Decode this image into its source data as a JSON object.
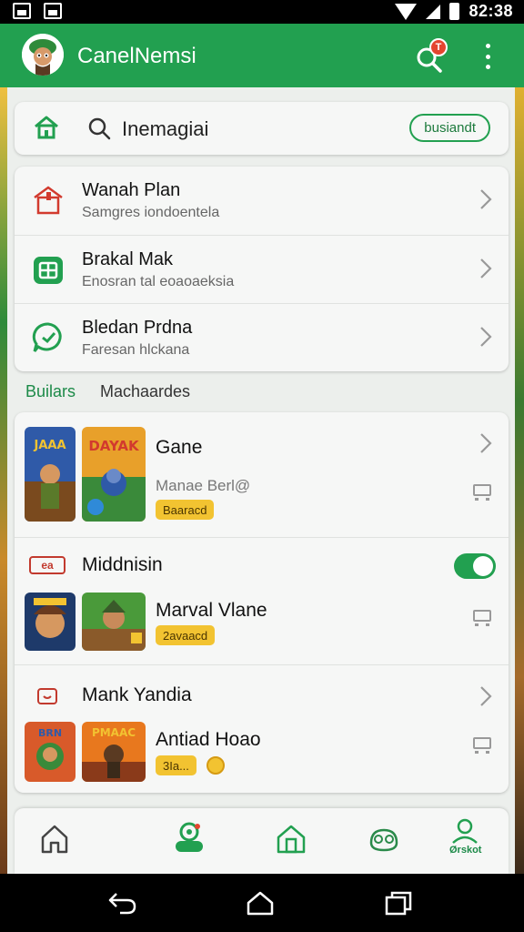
{
  "status_bar": {
    "time": "82:38"
  },
  "app_bar": {
    "title": "CanelNemsi",
    "notification_badge": "T"
  },
  "search": {
    "text": "Inemagiai",
    "pill_label": "busiandt"
  },
  "menu": [
    {
      "title": "Wanah Plan",
      "subtitle": "Samgres iondoentela",
      "icon": "shop-icon"
    },
    {
      "title": "Brakal Mak",
      "subtitle": "Enosran tal eoaoaeksia",
      "icon": "calendar-icon"
    },
    {
      "title": "Bledan Prdna",
      "subtitle": "Faresan hlckana",
      "icon": "chat-icon"
    }
  ],
  "tabs": [
    {
      "label": "Builars",
      "active": true
    },
    {
      "label": "Machaardes",
      "active": false
    }
  ],
  "sections": [
    {
      "title": "Gane",
      "subtitle": "Manae Berl@",
      "tag": "Baaracd",
      "thumb_texts": [
        "JAAA",
        "DAYAK"
      ]
    },
    {
      "header_badge": "ea",
      "header_title": "Middnisin",
      "toggle_on": true,
      "title": "Marval Vlane",
      "tag": "2avaacd"
    },
    {
      "header_title": "Mank Yandia",
      "title": "Antiad Hoao",
      "tag": "3Ia...",
      "thumb_texts": [
        "BRN",
        "PMAAC"
      ]
    }
  ],
  "bottom_nav": {
    "profile_label": "Ørskot"
  },
  "colors": {
    "primary": "#22a050",
    "accent_yellow": "#f2c331",
    "badge_red": "#e4452f"
  }
}
